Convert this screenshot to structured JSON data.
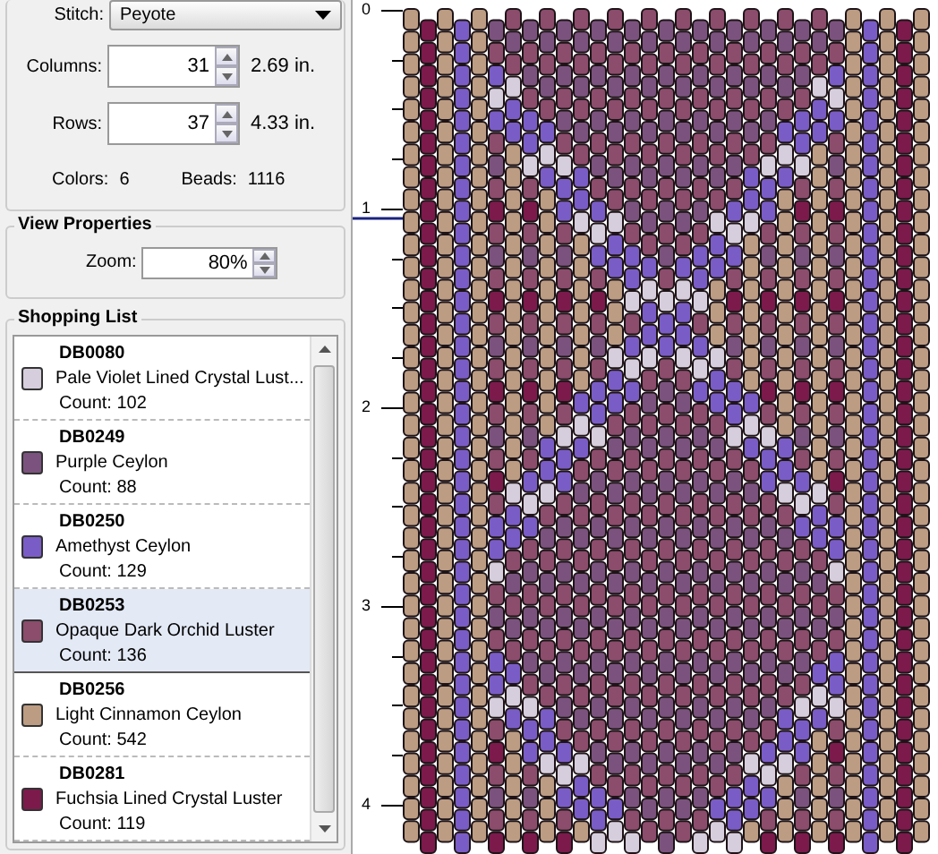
{
  "stitch": {
    "label": "Stitch:",
    "value": "Peyote"
  },
  "columns": {
    "label": "Columns:",
    "value": "31",
    "size": "2.69 in."
  },
  "rows": {
    "label": "Rows:",
    "value": "37",
    "size": "4.33 in."
  },
  "colors": {
    "label": "Colors:",
    "value": "6"
  },
  "beads": {
    "label": "Beads:",
    "value": "1116"
  },
  "view_properties": {
    "title": "View Properties",
    "zoom_label": "Zoom:",
    "zoom_value": "80%"
  },
  "shopping_list": {
    "title": "Shopping List",
    "items": [
      {
        "code": "DB0080",
        "name": "Pale Violet Lined Crystal Lust...",
        "count": "Count: 102",
        "color": "#d6cedc",
        "selected": false
      },
      {
        "code": "DB0249",
        "name": "Purple Ceylon",
        "count": "Count: 88",
        "color": "#7b527e",
        "selected": false
      },
      {
        "code": "DB0250",
        "name": "Amethyst Ceylon",
        "count": "Count: 129",
        "color": "#7a5cc6",
        "selected": false
      },
      {
        "code": "DB0253",
        "name": "Opaque Dark Orchid Luster",
        "count": "Count: 136",
        "color": "#8c4c6c",
        "selected": true
      },
      {
        "code": "DB0256",
        "name": "Light Cinnamon Ceylon",
        "count": "Count: 542",
        "color": "#bc9c82",
        "selected": false
      },
      {
        "code": "DB0281",
        "name": "Fuchsia Lined Crystal Luster",
        "count": "Count: 119",
        "color": "#7c1a4c",
        "selected": false
      }
    ]
  },
  "ruler": {
    "labels": [
      "0",
      "1",
      "2",
      "3",
      "4"
    ]
  }
}
